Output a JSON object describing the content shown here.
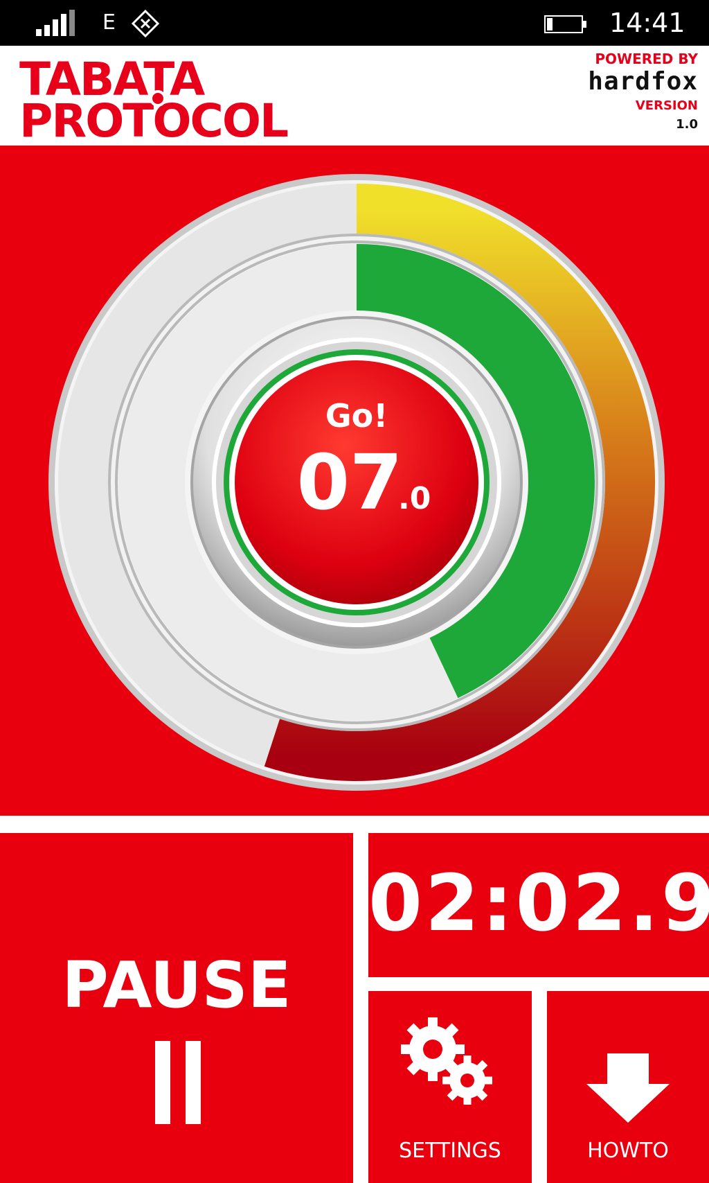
{
  "status_bar": {
    "network": "E",
    "time": "14:41"
  },
  "header": {
    "logo_line1": "TABATA",
    "logo_line2": "PROTOCOL",
    "powered_by": "POWERED BY",
    "brand": "hardfox",
    "version_label": "VERSION",
    "version_number": "1.0"
  },
  "gauge": {
    "status": "Go!",
    "seconds": "07",
    "tenths": ".0",
    "outer_ring_progress": 0.55,
    "inner_ring_progress": 0.43
  },
  "controls": {
    "pause_label": "PAUSE",
    "total_time": "02:02.9",
    "settings_label": "SETTINGS",
    "howto_label": "HOWTO"
  },
  "colors": {
    "primary_red": "#e8000f",
    "ring_green": "#1fa83a",
    "ring_yellow": "#f0e02a",
    "ring_orange": "#d8801a"
  }
}
